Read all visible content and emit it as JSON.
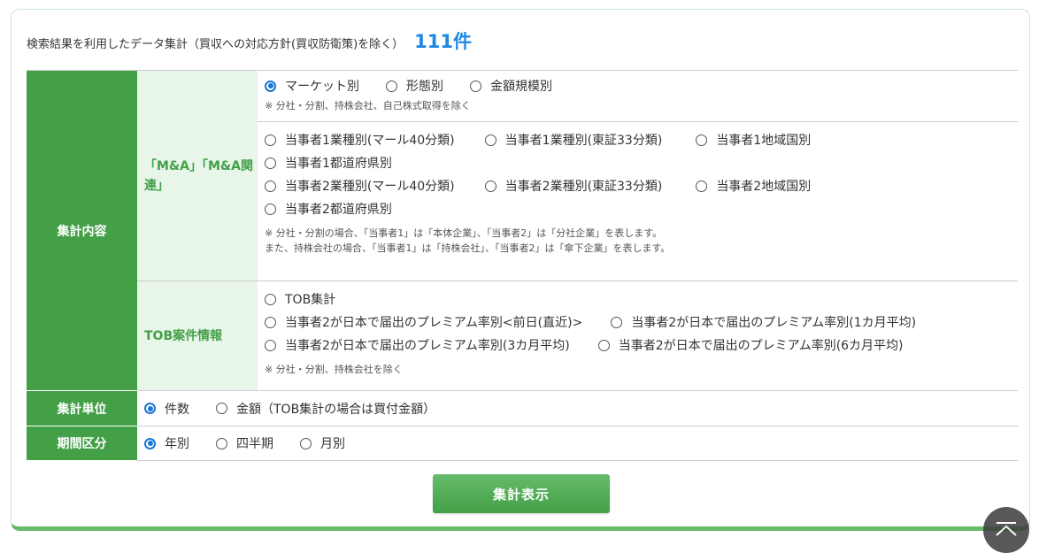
{
  "summary": {
    "label": "検索結果を利用したデータ集計（買収への対応方針(買収防衛策)を除く）",
    "count": "111件"
  },
  "sections": {
    "content_header": "集計内容",
    "ma": {
      "label": "「M&A」「M&A関連」",
      "group1": [
        "マーケット別",
        "形態別",
        "金額規模別"
      ],
      "note1": "※ 分社・分割、持株会社、自己株式取得を除く",
      "p1": [
        "当事者1業種別(マール40分類)",
        "当事者1業種別(東証33分類)",
        "当事者1地域国別"
      ],
      "p1_pref": "当事者1都道府県別",
      "p2": [
        "当事者2業種別(マール40分類)",
        "当事者2業種別(東証33分類)",
        "当事者2地域国別"
      ],
      "p2_pref": "当事者2都道府県別",
      "note2a": "※ 分社・分割の場合、「当事者1」は「本体企業」、「当事者2」は「分社企業」を表します。",
      "note2b": "また、持株会社の場合、「当事者1」は「持株会社」、「当事者2」は「傘下企業」を表します。"
    },
    "tob": {
      "label": "TOB案件情報",
      "opt_tob": "TOB集計",
      "row2": [
        "当事者2が日本で届出のプレミアム率別<前日(直近)>",
        "当事者2が日本で届出のプレミアム率別(1カ月平均)"
      ],
      "row3": [
        "当事者2が日本で届出のプレミアム率別(3カ月平均)",
        "当事者2が日本で届出のプレミアム率別(6カ月平均)"
      ],
      "note": "※ 分社・分割、持株会社を除く"
    },
    "unit": {
      "header": "集計単位",
      "options": [
        "件数",
        "金額（TOB集計の場合は買付金額）"
      ]
    },
    "period": {
      "header": "期間区分",
      "options": [
        "年別",
        "四半期",
        "月別"
      ]
    }
  },
  "button": {
    "label": "集計表示"
  },
  "scroll_top_icon": "chevron-up-icon"
}
